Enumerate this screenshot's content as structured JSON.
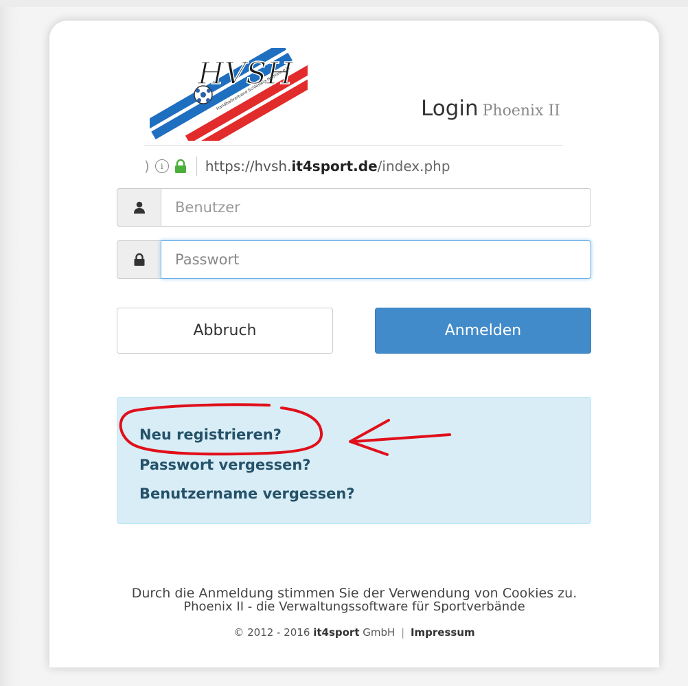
{
  "header": {
    "logo_text": "HVSH",
    "logo_subtext": "Handballverband Schleswig-Holstein e.V.",
    "title": "Login",
    "subtitle": "Phoenix II"
  },
  "urlbar": {
    "paren": ")",
    "url_prefix": "https://hvsh.",
    "url_host": "it4sport.de",
    "url_path": "/index.php"
  },
  "form": {
    "username_placeholder": "Benutzer",
    "password_placeholder": "Passwort",
    "cancel_label": "Abbruch",
    "submit_label": "Anmelden"
  },
  "links": {
    "register": "Neu registrieren?",
    "forgot_password": "Passwort vergessen?",
    "forgot_username": "Benutzername vergessen?"
  },
  "footer": {
    "cookie_notice": "Durch die Anmeldung stimmen Sie der Verwendung von Cookies zu.",
    "tagline": "Phoenix II - die Verwaltungssoftware für Sportverbände",
    "copyright_prefix": "© 2012 - 2016",
    "company_brand": "it4sport",
    "company_suffix": "GmbH",
    "separator": "|",
    "impressum": "Impressum"
  },
  "icons": {
    "username": "user-icon",
    "password": "lock-icon",
    "site_info": "info-icon",
    "secure": "padlock-icon"
  },
  "colors": {
    "primary_button": "#428bca",
    "info_box_bg": "#d9edf7",
    "link_color": "#245269",
    "annotation_red": "#e0101a",
    "logo_blue": "#1f6fc0",
    "logo_red": "#e22b2b",
    "secure_green": "#4caf3c"
  }
}
